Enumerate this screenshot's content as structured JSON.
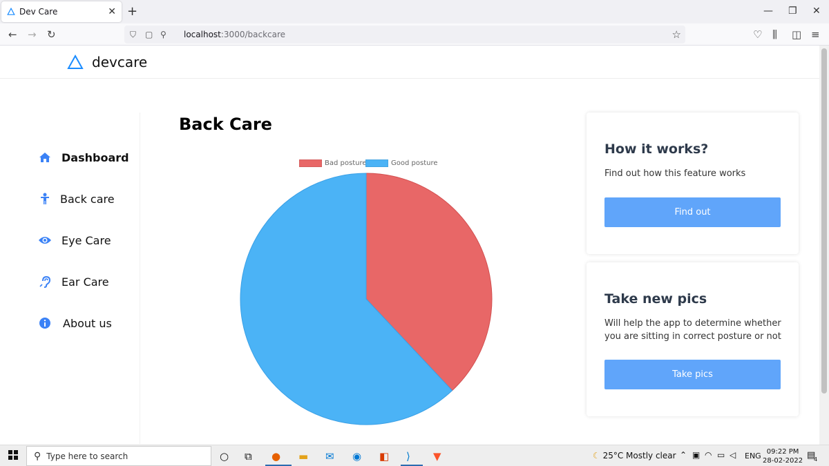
{
  "browser": {
    "tab_title": "Dev Care",
    "tab_close": "✕",
    "new_tab": "+",
    "url_host": "localhost",
    "url_rest": ":3000/backcare",
    "win_min": "—",
    "win_restore": "❐",
    "win_close": "✕"
  },
  "app": {
    "logo_text": "devcare",
    "page_title": "Back Care"
  },
  "sidebar": {
    "items": [
      {
        "label": "Dashboard",
        "icon": "home-icon"
      },
      {
        "label": "Back care",
        "icon": "person-icon"
      },
      {
        "label": "Eye Care",
        "icon": "eye-icon"
      },
      {
        "label": "Ear Care",
        "icon": "ear-icon"
      },
      {
        "label": "About us",
        "icon": "info-icon"
      }
    ],
    "accent": "#3b82f6"
  },
  "chart_data": {
    "type": "pie",
    "labels": [
      "Bad posture",
      "Good posture"
    ],
    "values": [
      38,
      62
    ],
    "colors": [
      "#e86767",
      "#4bb3f6"
    ],
    "legend_position": "top"
  },
  "cards": [
    {
      "title": "How it works?",
      "text": "Find out how this feature works",
      "button": "Find out"
    },
    {
      "title": "Take new pics",
      "text": "Will help the app to determine whether you are sitting in correct posture or not",
      "button": "Take pics"
    }
  ],
  "taskbar": {
    "search_placeholder": "Type here to search",
    "weather": "25°C  Mostly clear",
    "lang": "ENG",
    "time": "09:22 PM",
    "date": "28-02-2022",
    "notif_count": "4"
  }
}
